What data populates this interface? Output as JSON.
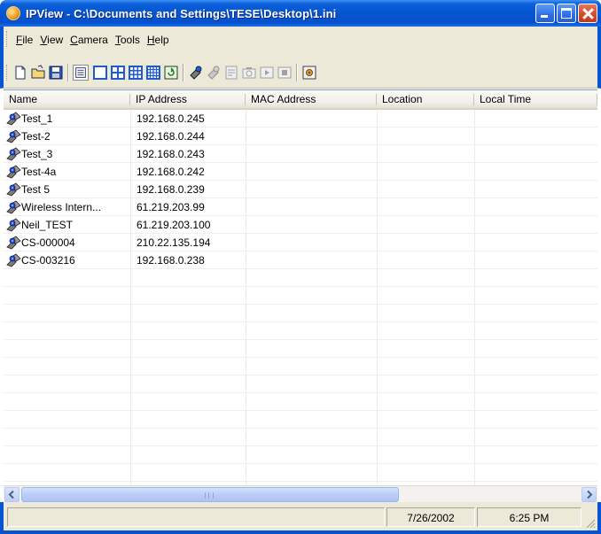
{
  "window": {
    "title": "IPView - C:\\Documents and Settings\\TESE\\Desktop\\1.ini"
  },
  "menu": [
    {
      "label": "File",
      "accel": "F"
    },
    {
      "label": "View",
      "accel": "V"
    },
    {
      "label": "Camera",
      "accel": "C"
    },
    {
      "label": "Tools",
      "accel": "T"
    },
    {
      "label": "Help",
      "accel": "H"
    }
  ],
  "toolbar": {
    "buttons": [
      "new-file-icon",
      "open-folder-icon",
      "save-disk-icon",
      "details-view-icon",
      "single-view-icon",
      "quad-view-icon",
      "nine-view-icon",
      "sixteen-view-icon",
      "refresh-view-icon",
      "connect-camera-icon",
      "disconnect-camera-icon",
      "properties-icon",
      "snapshot-icon",
      "play-icon",
      "stop-icon",
      "settings-icon"
    ]
  },
  "list": {
    "columns": [
      "Name",
      "IP Address",
      "MAC Address",
      "Location",
      "Local Time"
    ],
    "rows": [
      {
        "name": "Test_1",
        "ip": "192.168.0.245"
      },
      {
        "name": "Test-2",
        "ip": "192.168.0.244"
      },
      {
        "name": "Test_3",
        "ip": "192.168.0.243"
      },
      {
        "name": "Test-4a",
        "ip": "192.168.0.242"
      },
      {
        "name": "Test 5",
        "ip": "192.168.0.239"
      },
      {
        "name": "Wireless Intern...",
        "ip": "61.219.203.99"
      },
      {
        "name": "Neil_TEST",
        "ip": "61.219.203.100"
      },
      {
        "name": "CS-000004",
        "ip": "210.22.135.194"
      },
      {
        "name": "CS-003216",
        "ip": "192.168.0.238"
      }
    ]
  },
  "status": {
    "date": "7/26/2002",
    "time": "6:25 PM"
  },
  "colors": {
    "title_bar": "#0654d1",
    "close_button": "#d34a2a",
    "chrome": "#ece9d8"
  }
}
